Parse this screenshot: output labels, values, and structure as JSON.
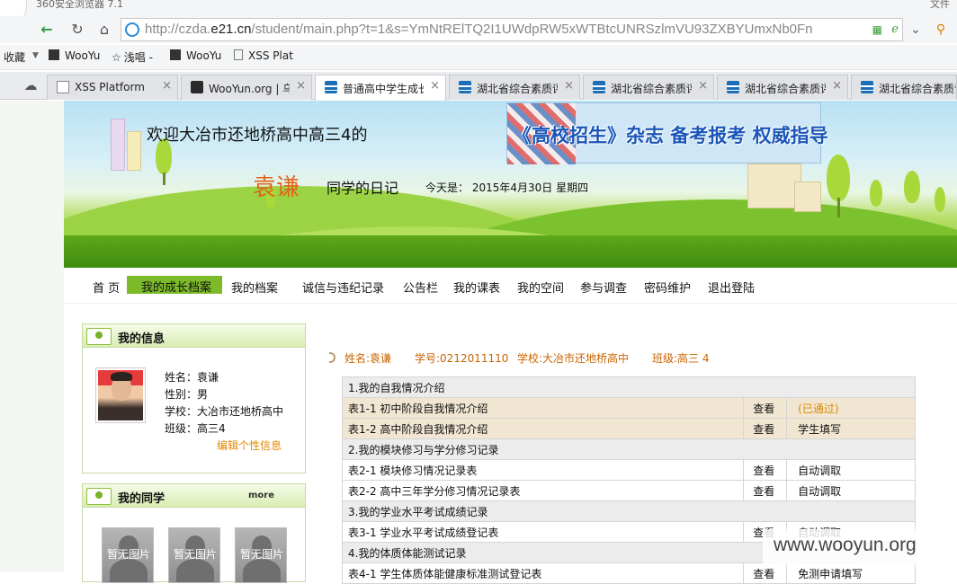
{
  "browser": {
    "app_title": "360安全浏览器 7.1",
    "window_menu": "文件",
    "url_prefix": "http://czda.",
    "url_domain": "e21.cn",
    "url_suffix": "/student/main.php?t=1&s=YmNtRElTQ2I1UWdpRW5xWTBtcUNRSzlmVU93ZXBYUmxNb0Fn",
    "bookmarks": [
      "收藏",
      "WooYu",
      "浅唱 -",
      "WooYu",
      "XSS Plat"
    ],
    "tabs": [
      {
        "label": "XSS Platform",
        "icon": "page-icon"
      },
      {
        "label": "WooYun.org | 乌云",
        "icon": "dark-icon"
      },
      {
        "label": "普通高中学生成长",
        "icon": "wave-icon"
      },
      {
        "label": "湖北省综合素质评",
        "icon": "wave-icon"
      },
      {
        "label": "湖北省综合素质评",
        "icon": "wave-icon"
      },
      {
        "label": "湖北省综合素质评",
        "icon": "wave-icon"
      },
      {
        "label": "湖北省综合素质评",
        "icon": "wave-icon"
      }
    ]
  },
  "banner": {
    "welcome": "欢迎大冶市还地桥高中高三4的",
    "ad_text": "《高校招生》杂志  备考报考  权威指导",
    "student_name": "袁谦",
    "diary_label": "同学的日记",
    "today": "今天是： 2015年4月30日  星期四"
  },
  "menu": [
    "首 页",
    "我的成长档案",
    "我的档案",
    "诚信与违纪记录",
    "公告栏",
    "我的课表",
    "我的空间",
    "参与调查",
    "密码维护",
    "退出登陆"
  ],
  "my_info": {
    "title": "我的信息",
    "name": "姓名：袁谦",
    "gender": "性别：男",
    "school": "学校：大冶市还地桥高中",
    "class": "班级：高三4",
    "edit_link": "编辑个性信息"
  },
  "classmates": {
    "title": "我的同学",
    "more": "more",
    "items": [
      "暂无图片",
      "暂无图片",
      "暂无图片"
    ]
  },
  "summary": {
    "name": "姓名:袁谦",
    "id": "学号:0212011110",
    "school": "学校:大冶市还地桥高中",
    "class": "班级:高三 4"
  },
  "records": {
    "sec1": "1.我的自我情况介绍",
    "r1": {
      "name": "表1-1  初中阶段自我情况介绍",
      "action": "查看",
      "status": "(已通过)"
    },
    "r2": {
      "name": "表1-2  高中阶段自我情况介绍",
      "action": "查看",
      "status": "学生填写"
    },
    "sec2": "2.我的模块修习与学分修习记录",
    "r3": {
      "name": "表2-1  模块修习情况记录表",
      "action": "查看",
      "status": "自动调取"
    },
    "r4": {
      "name": "表2-2  高中三年学分修习情况记录表",
      "action": "查看",
      "status": "自动调取"
    },
    "sec3": "3.我的学业水平考试成绩记录",
    "r5": {
      "name": "表3-1  学业水平考试成绩登记表",
      "action": "查看",
      "status": "自动调取"
    },
    "sec4": "4.我的体质体能测试记录",
    "r6": {
      "name": "表4-1  学生体质体能健康标准测试登记表",
      "action": "查看",
      "status": "免测申请填写"
    }
  },
  "watermark": "www.wooyun.org"
}
